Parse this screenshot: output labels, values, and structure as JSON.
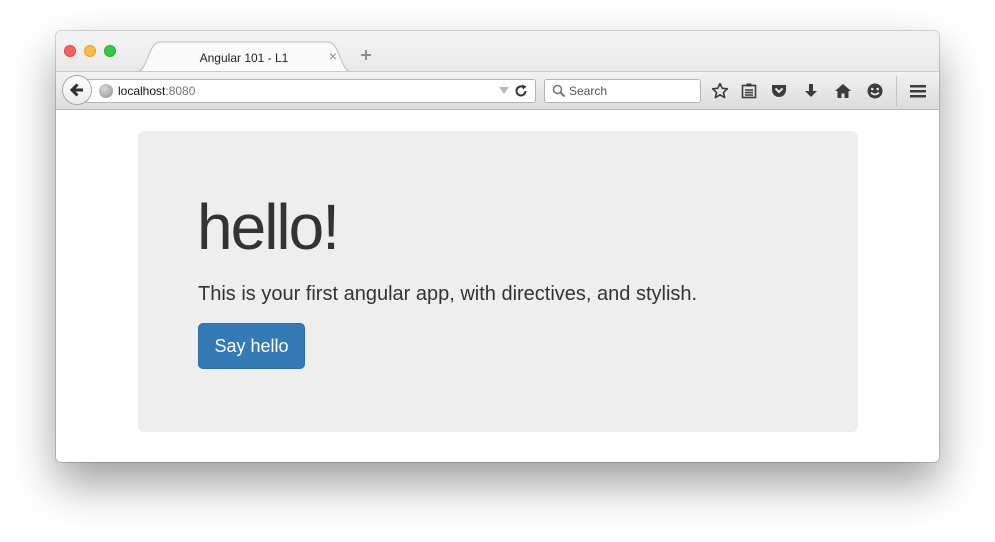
{
  "browser": {
    "tab": {
      "title": "Angular 101 - L1",
      "close_glyph": "×"
    },
    "url": {
      "host": "localhost",
      "port": ":8080"
    },
    "search": {
      "placeholder": "Search"
    },
    "toolbar_icons": [
      "star-icon",
      "reading-list-icon",
      "pocket-icon",
      "download-icon",
      "home-icon",
      "hello-icon",
      "menu-icon"
    ]
  },
  "page": {
    "heading": "hello!",
    "lead": "This is your first angular app, with directives, and stylish.",
    "button_label": "Say hello"
  },
  "colors": {
    "button_primary": "#337ab7",
    "jumbotron_bg": "#eeeeee",
    "text": "#333333"
  }
}
